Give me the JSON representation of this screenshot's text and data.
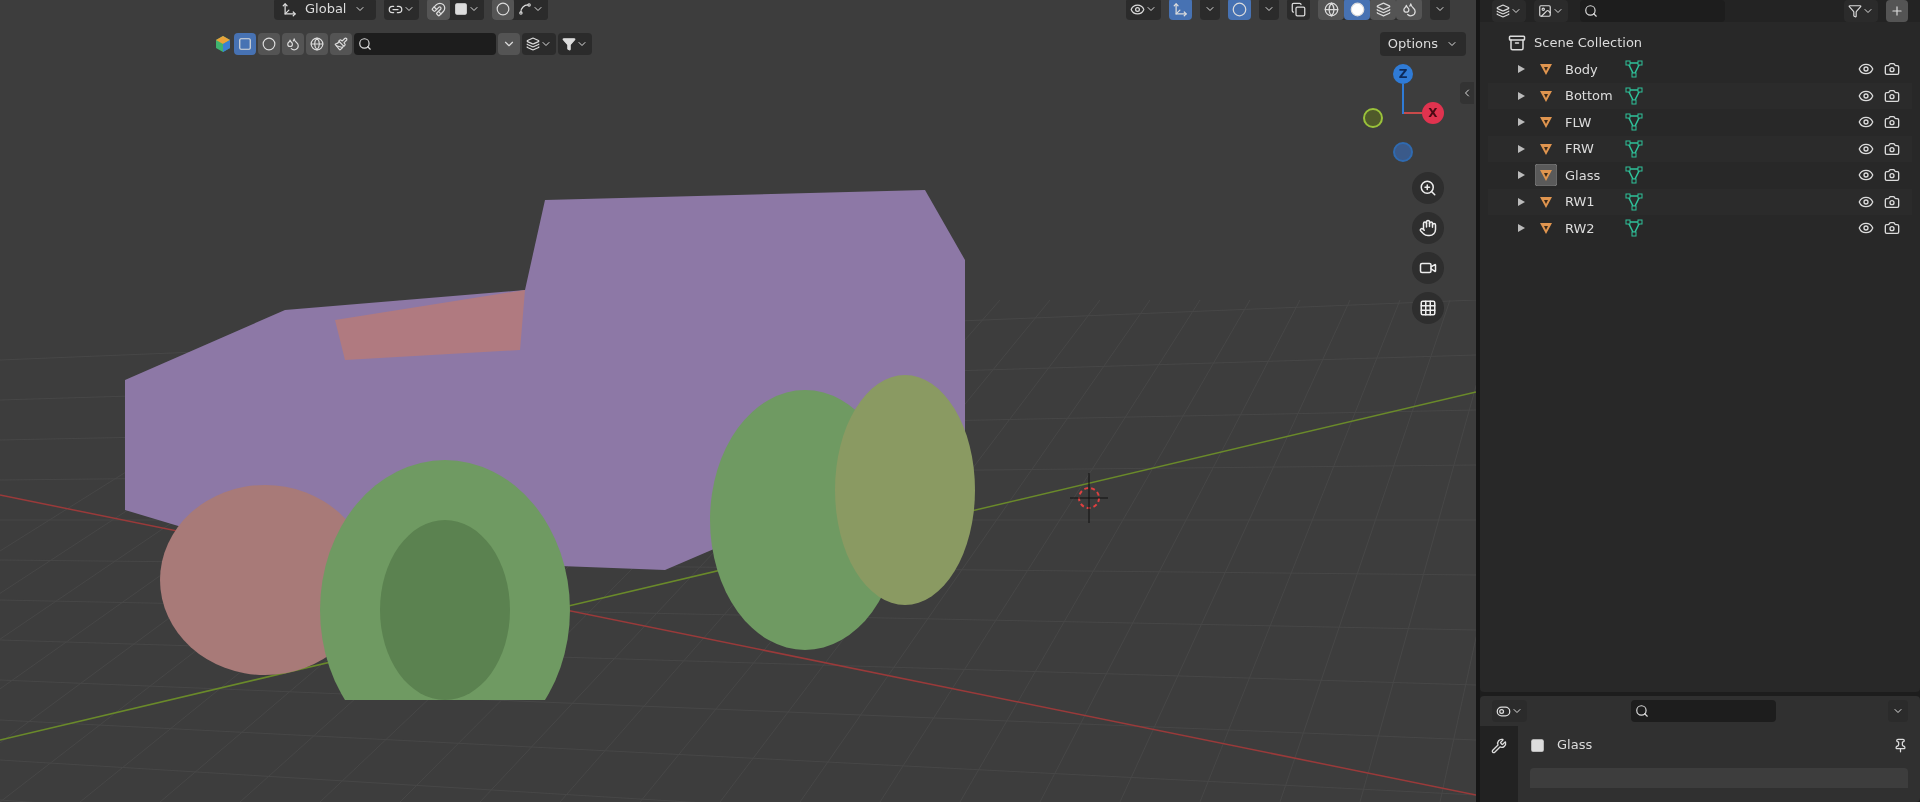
{
  "viewport": {
    "orientation": "Global",
    "options": "Options",
    "shading_modes": [
      {
        "selected": false
      },
      {
        "selected": true
      },
      {
        "selected": false
      },
      {
        "selected": false
      }
    ],
    "header_toggles": [
      {
        "on": true
      },
      {
        "on": true
      }
    ],
    "gizmo": [
      {
        "label": "Z",
        "color": "#2f7bd6"
      },
      {
        "label": "X",
        "color": "#e0334f"
      }
    ]
  },
  "outliner": {
    "root": "Scene Collection",
    "items": [
      {
        "name": "Body",
        "active": false
      },
      {
        "name": "Bottom",
        "active": false
      },
      {
        "name": "FLW",
        "active": false
      },
      {
        "name": "FRW",
        "active": false
      },
      {
        "name": "Glass",
        "active": true
      },
      {
        "name": "RW1",
        "active": false
      },
      {
        "name": "RW2",
        "active": false
      }
    ]
  },
  "properties": {
    "object_name": "Glass"
  }
}
